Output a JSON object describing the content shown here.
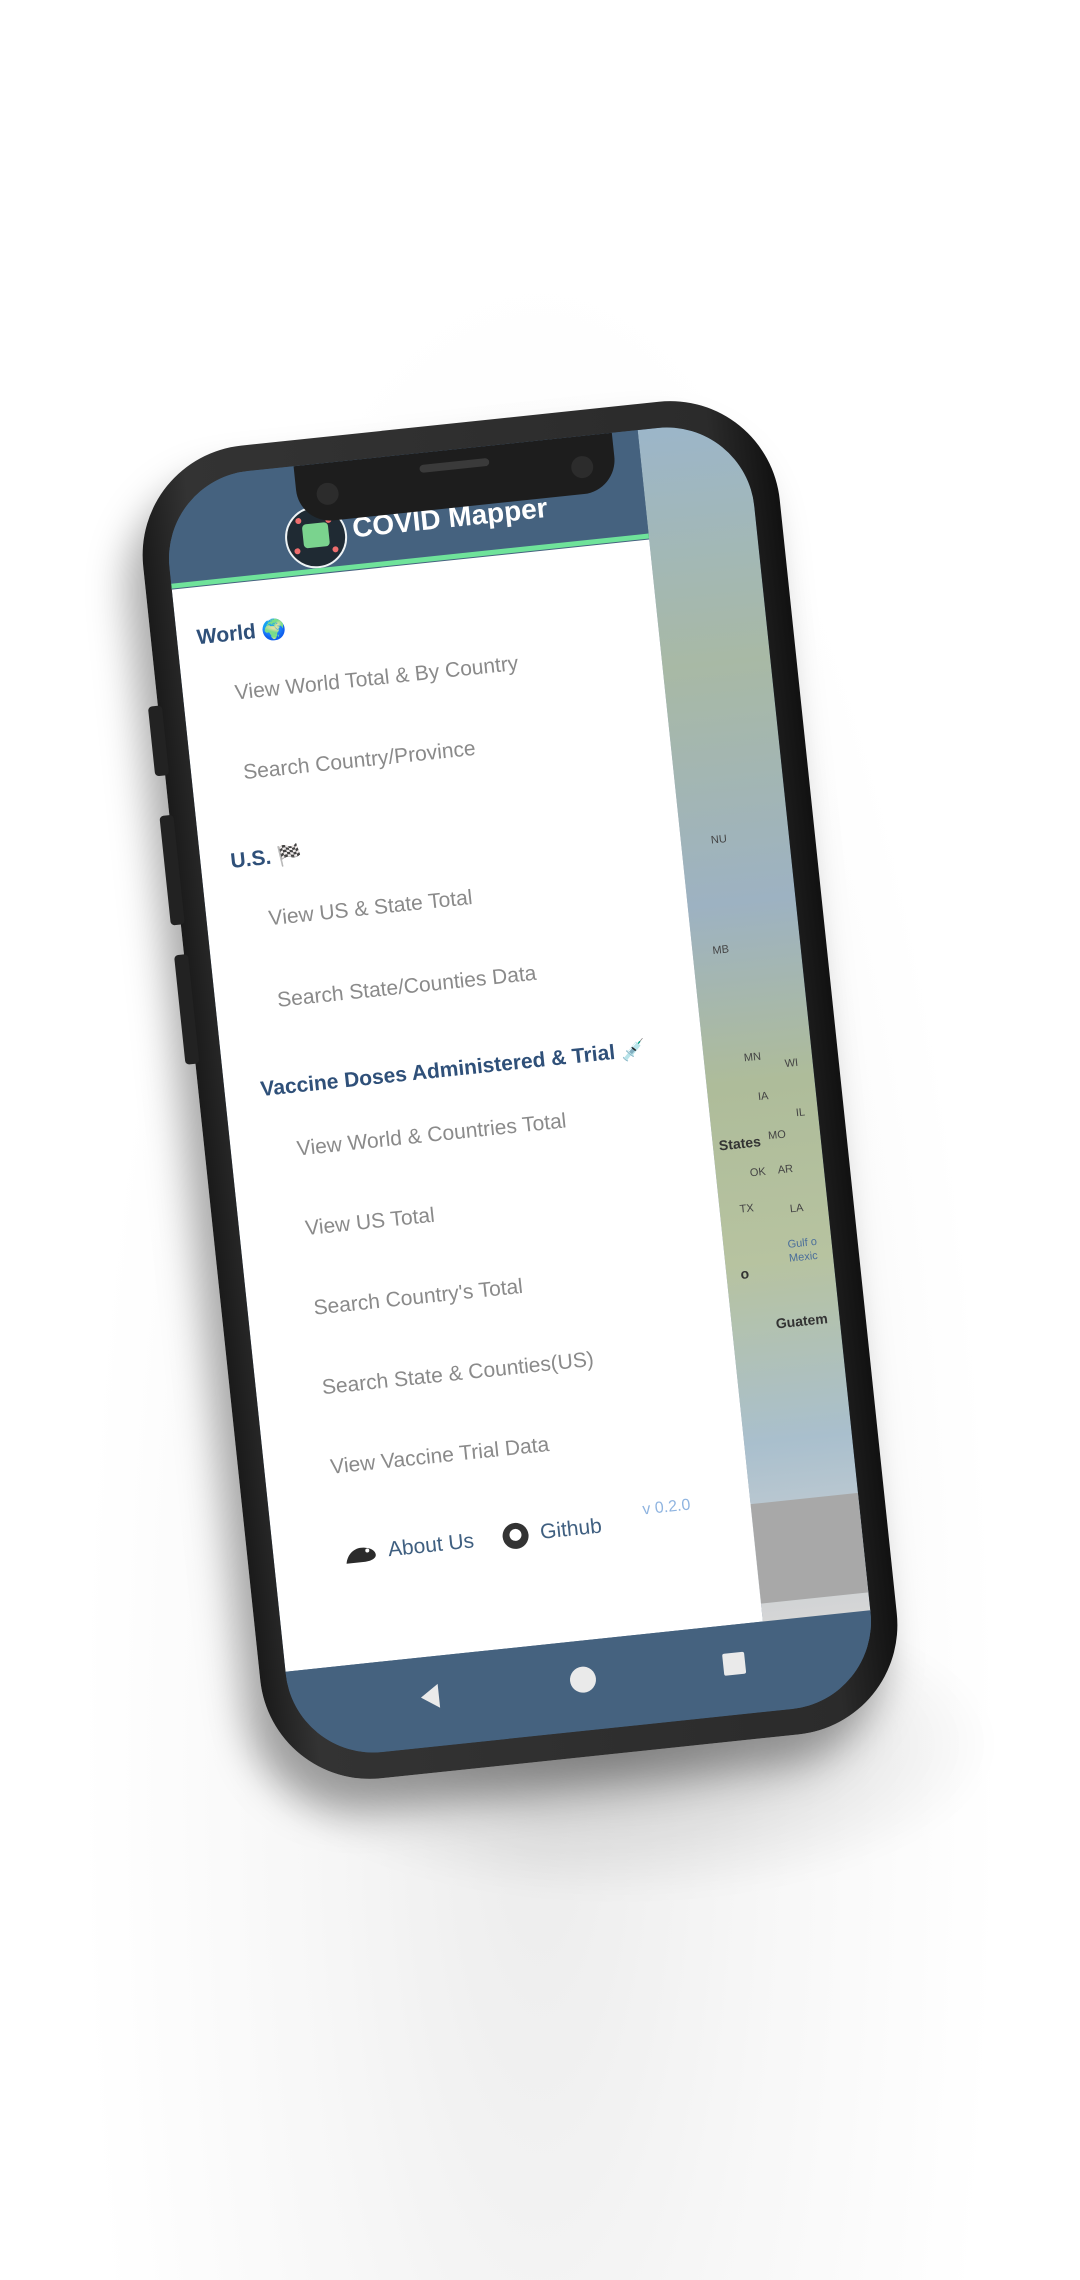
{
  "app": {
    "title": "COVID Mapper"
  },
  "drawer": {
    "sections": [
      {
        "title": "World",
        "icon": "🌍",
        "items": [
          "View World Total & By Country",
          "Search Country/Province"
        ]
      },
      {
        "title": "U.S.",
        "icon": "🏁",
        "items": [
          "View US & State Total",
          "Search State/Counties Data"
        ]
      },
      {
        "title": "Vaccine Doses Administered & Trial",
        "icon": "💉",
        "items": [
          "View World & Countries Total",
          "View US Total",
          "Search Country's Total",
          "Search State & Counties(US)",
          "View Vaccine Trial Data"
        ]
      }
    ],
    "footer": {
      "about_label": "About Us",
      "github_label": "Github",
      "version": "v 0.2.0"
    }
  },
  "map": {
    "labels": [
      "NU",
      "MB",
      "MN",
      "WI",
      "IA",
      "IL",
      "MO",
      "OK",
      "AR",
      "TX",
      "LA",
      "States",
      "Gulf o",
      "Mexic",
      "o",
      "Guatem"
    ]
  },
  "colors": {
    "header": "#45627f",
    "accent_line": "#6fe39a",
    "section_title": "#2f5079",
    "menu_item": "#8a8a8a",
    "version": "#8fb4e0"
  }
}
